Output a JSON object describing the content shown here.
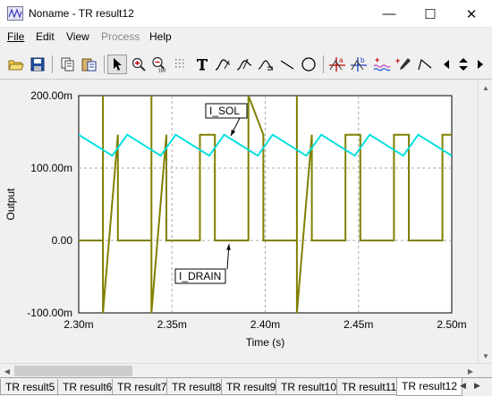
{
  "window": {
    "title": "Noname - TR result12",
    "minimize_glyph": "—",
    "maximize_glyph": "☐",
    "close_glyph": "✕"
  },
  "menu": {
    "file": "File",
    "edit": "Edit",
    "view": "View",
    "process": "Process",
    "help": "Help"
  },
  "toolbar": {
    "icons": [
      "open-folder-icon",
      "save-icon",
      "copy-icon",
      "paste-icon",
      "pointer-icon",
      "zoom-in-icon",
      "zoom-out-icon",
      "grid-icon",
      "text-tool-icon",
      "curve-tool-icon",
      "curve-tool-2-icon",
      "bar-tool-icon",
      "line-tool-icon",
      "ellipse-tool-icon",
      "cursor-a-icon",
      "cursor-b-icon",
      "add-trace-icon",
      "remove-trace-icon",
      "dropper-icon",
      "polyline-icon",
      "prev-icon",
      "next-icon"
    ]
  },
  "chart_data": {
    "type": "line",
    "ylabel": "Output",
    "xlabel": "Time (s)",
    "xlim": [
      2.3,
      2.5
    ],
    "ylim": [
      -0.1,
      0.2
    ],
    "x_ticks": [
      "2.30m",
      "2.35m",
      "2.40m",
      "2.45m",
      "2.50m"
    ],
    "y_ticks": [
      "200.00m",
      "100.00m",
      "0.00",
      "-100.00m"
    ],
    "grid": true,
    "background": "#ffffff",
    "series": [
      {
        "name": "I_SOL",
        "color": "#00e0e0",
        "x": [
          2.3,
          2.318,
          2.326,
          2.344,
          2.352,
          2.37,
          2.378,
          2.396,
          2.404,
          2.422,
          2.43,
          2.448,
          2.456,
          2.474,
          2.482,
          2.5
        ],
        "y": [
          0.146,
          0.117,
          0.146,
          0.117,
          0.146,
          0.117,
          0.146,
          0.117,
          0.146,
          0.117,
          0.146,
          0.117,
          0.146,
          0.117,
          0.146,
          0.117
        ]
      },
      {
        "name": "I_DRAIN",
        "color": "#808000",
        "x": [
          2.3,
          2.313,
          2.313,
          2.313,
          2.321,
          2.321,
          2.339,
          2.339,
          2.339,
          2.347,
          2.347,
          2.365,
          2.365,
          2.373,
          2.373,
          2.391,
          2.391,
          2.399,
          2.399,
          2.417,
          2.417,
          2.417,
          2.425,
          2.425,
          2.443,
          2.443,
          2.451,
          2.451,
          2.469,
          2.469,
          2.477,
          2.477,
          2.495,
          2.495,
          2.5
        ],
        "y": [
          0.0,
          0.0,
          0.2,
          -0.1,
          0.146,
          0.0,
          0.0,
          0.2,
          -0.1,
          0.146,
          0.0,
          0.0,
          0.146,
          0.146,
          0.0,
          0.0,
          0.2,
          0.146,
          0.0,
          0.0,
          0.2,
          -0.1,
          0.146,
          0.0,
          0.0,
          0.146,
          0.146,
          0.0,
          0.0,
          0.146,
          0.146,
          0.0,
          0.0,
          0.146,
          0.146
        ]
      }
    ],
    "annotations": [
      {
        "label": "I_SOL",
        "series": "I_SOL"
      },
      {
        "label": "I_DRAIN",
        "series": "I_DRAIN"
      }
    ]
  },
  "tabs": [
    "TR result5",
    "TR result6",
    "TR result7",
    "TR result8",
    "TR result9",
    "TR result10",
    "TR result11",
    "TR result12"
  ],
  "active_tab": "TR result12"
}
